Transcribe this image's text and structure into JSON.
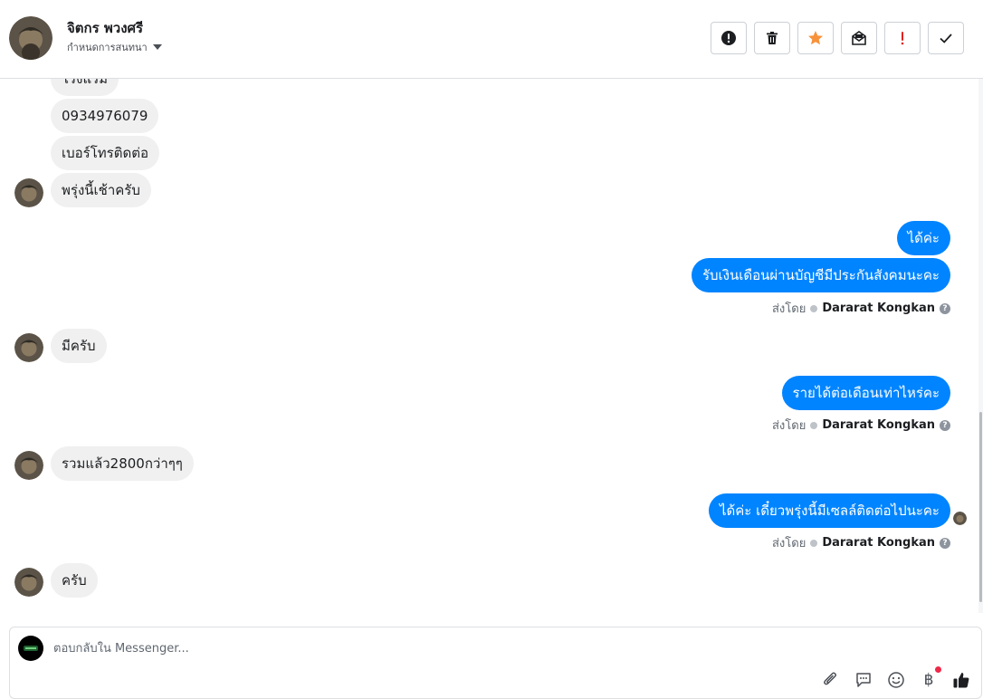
{
  "header": {
    "contact_name": "จิตกร พวงศรี",
    "assign_label": "กำหนดการสนทนา",
    "actions": [
      {
        "name": "spam-button",
        "icon": "exclamation-circle-icon"
      },
      {
        "name": "delete-button",
        "icon": "trash-icon"
      },
      {
        "name": "follow-up-button",
        "icon": "star-icon"
      },
      {
        "name": "mark-unread-button",
        "icon": "envelope-icon"
      },
      {
        "name": "priority-button",
        "icon": "exclamation-icon"
      },
      {
        "name": "done-button",
        "icon": "check-icon"
      }
    ]
  },
  "messages": [
    {
      "dir": "in",
      "text": "โรงแรม"
    },
    {
      "dir": "in",
      "text": "0934976079"
    },
    {
      "dir": "in",
      "text": "เบอร์โทรติดต่อ"
    },
    {
      "dir": "in",
      "text": "พรุ่งนี้เช้าครับ"
    },
    {
      "dir": "out",
      "text": "ได้ค่ะ"
    },
    {
      "dir": "out",
      "text": "รับเงินเดือนผ่านบัญชีมีประกันสังคมนะคะ"
    },
    {
      "dir": "in",
      "text": "มีครับ"
    },
    {
      "dir": "out",
      "text": "รายได้ต่อเดือนเท่าไหร่คะ"
    },
    {
      "dir": "in",
      "text": "รวมแล้ว2800กว่าๆๆ"
    },
    {
      "dir": "out",
      "text": "ได้ค่ะ เดี๋ยวพรุ่งนี้มีเซลล์ติดต่อไปนะคะ"
    },
    {
      "dir": "in",
      "text": "ครับ"
    }
  ],
  "sent_by": {
    "prefix": "ส่งโดย",
    "agent": "Dararat Kongkan",
    "help": "?"
  },
  "composer": {
    "placeholder": "ตอบกลับใน Messenger...",
    "baht_symbol": "฿",
    "tools": [
      "paperclip-icon",
      "saved-reply-icon",
      "emoji-icon",
      "payment-icon",
      "like-icon"
    ]
  },
  "colors": {
    "outgoing_bubble": "#0084ff",
    "incoming_bubble": "#f0f0f0",
    "star": "#f7923b",
    "priority": "#e02020",
    "badge": "#f02849"
  }
}
